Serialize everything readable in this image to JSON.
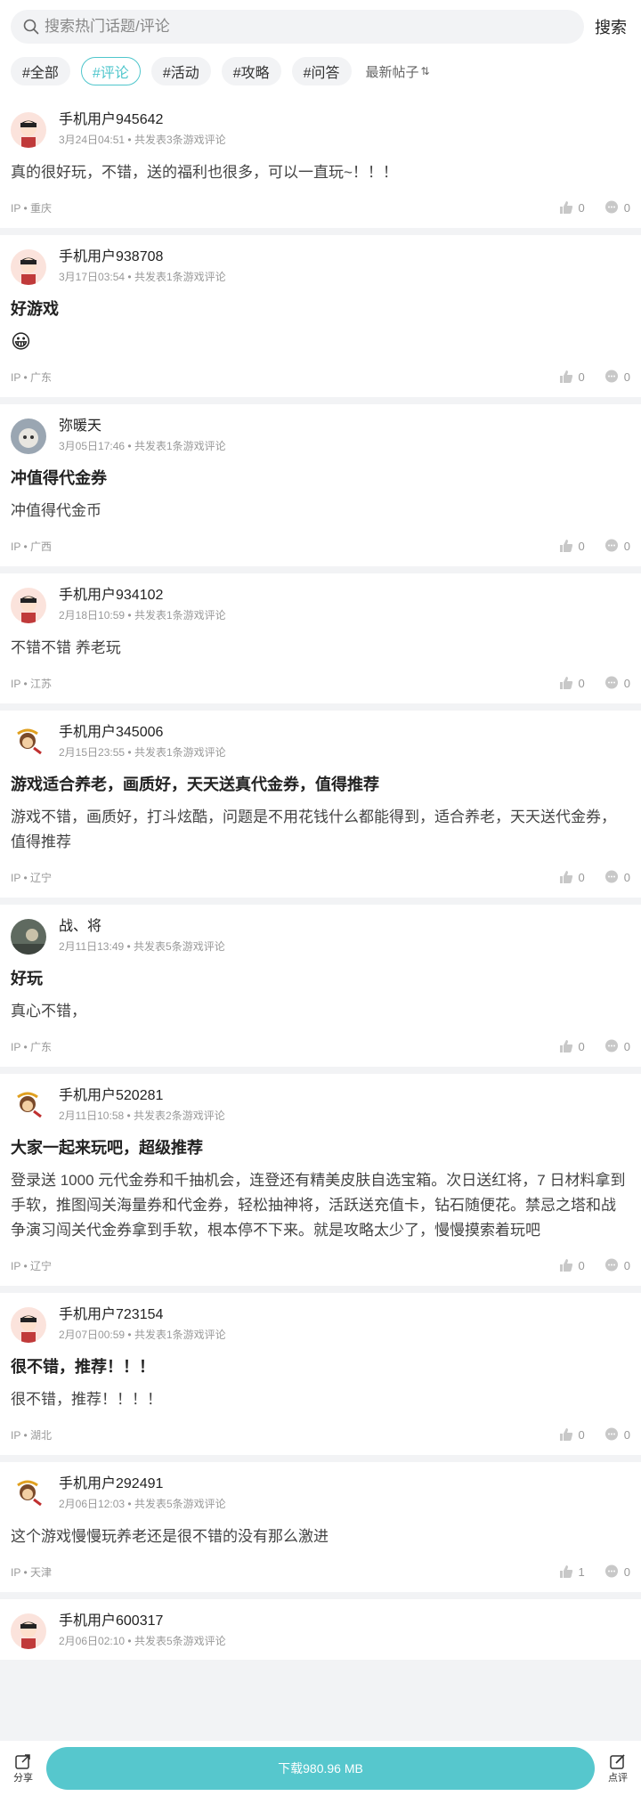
{
  "search": {
    "placeholder": "搜索热门话题/评论",
    "button": "搜索"
  },
  "filters": [
    "#全部",
    "#评论",
    "#活动",
    "#攻略",
    "#问答"
  ],
  "active_filter_index": 1,
  "sort_label": "最新帖子",
  "posts": [
    {
      "user": "手机用户945642",
      "date": "3月24日04:51",
      "meta": "共发表3条游戏评论",
      "title": "",
      "body": "真的很好玩，不错，送的福利也很多，可以一直玩~！！！",
      "emoji": "",
      "ip": "IP • 重庆",
      "likes": "0",
      "comments": "0",
      "avatar": "boy"
    },
    {
      "user": "手机用户938708",
      "date": "3月17日03:54",
      "meta": "共发表1条游戏评论",
      "title": "好游戏",
      "body": "",
      "emoji": "😀",
      "ip": "IP • 广东",
      "likes": "0",
      "comments": "0",
      "avatar": "boy"
    },
    {
      "user": "弥暖天",
      "date": "3月05日17:46",
      "meta": "共发表1条游戏评论",
      "title": "冲值得代金券",
      "body": "冲值得代金币",
      "emoji": "",
      "ip": "IP • 广西",
      "likes": "0",
      "comments": "0",
      "avatar": "photo"
    },
    {
      "user": "手机用户934102",
      "date": "2月18日10:59",
      "meta": "共发表1条游戏评论",
      "title": "",
      "body": "不错不错 养老玩",
      "emoji": "",
      "ip": "IP • 江苏",
      "likes": "0",
      "comments": "0",
      "avatar": "boy"
    },
    {
      "user": "手机用户345006",
      "date": "2月15日23:55",
      "meta": "共发表1条游戏评论",
      "title": "游戏适合养老，画质好，天天送真代金券，值得推荐",
      "body": "游戏不错，画质好，打斗炫酷，问题是不用花钱什么都能得到，适合养老，天天送代金券，值得推荐",
      "emoji": "",
      "ip": "IP • 辽宁",
      "likes": "0",
      "comments": "0",
      "avatar": "monkey"
    },
    {
      "user": "战、将",
      "date": "2月11日13:49",
      "meta": "共发表5条游戏评论",
      "title": "好玩",
      "body": "真心不错，",
      "emoji": "",
      "ip": "IP • 广东",
      "likes": "0",
      "comments": "0",
      "avatar": "photo2"
    },
    {
      "user": "手机用户520281",
      "date": "2月11日10:58",
      "meta": "共发表2条游戏评论",
      "title": "大家一起来玩吧，超级推荐",
      "body": "登录送 1000 元代金券和千抽机会，连登还有精美皮肤自选宝箱。次日送红将，7 日材料拿到手软，推图闯关海量券和代金券，轻松抽神将，活跃送充值卡，钻石随便花。禁忌之塔和战争演习闯关代金券拿到手软，根本停不下来。就是攻略太少了，慢慢摸索着玩吧",
      "emoji": "",
      "ip": "IP • 辽宁",
      "likes": "0",
      "comments": "0",
      "avatar": "monkey"
    },
    {
      "user": "手机用户723154",
      "date": "2月07日00:59",
      "meta": "共发表1条游戏评论",
      "title": "很不错，推荐！！！",
      "body": "很不错，推荐！！！！",
      "emoji": "",
      "ip": "IP • 湖北",
      "likes": "0",
      "comments": "0",
      "avatar": "boy"
    },
    {
      "user": "手机用户292491",
      "date": "2月06日12:03",
      "meta": "共发表5条游戏评论",
      "title": "",
      "body": "这个游戏慢慢玩养老还是很不错的没有那么激进",
      "emoji": "",
      "ip": "IP • 天津",
      "likes": "1",
      "comments": "0",
      "avatar": "monkey"
    },
    {
      "user": "手机用户600317",
      "date": "2月06日02:10",
      "meta": "共发表5条游戏评论",
      "title": "",
      "body": "",
      "emoji": "",
      "ip": "",
      "likes": "",
      "comments": "",
      "avatar": "boy"
    }
  ],
  "bottom": {
    "share": "分享",
    "download": "下载980.96 MB",
    "review": "点评"
  },
  "colors": {
    "accent": "#4fc6cc",
    "download_bg": "#56c7cd"
  }
}
